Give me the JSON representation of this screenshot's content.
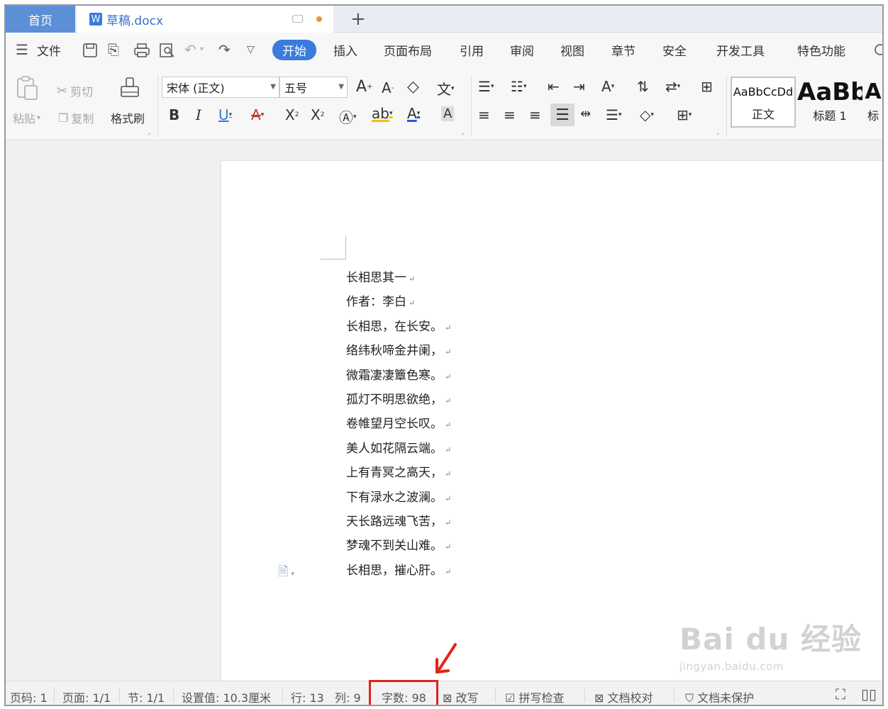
{
  "tabs": {
    "home_label": "首页",
    "doc_icon": "W",
    "doc_title": "草稿.docx",
    "add_label": "+"
  },
  "menu": {
    "file": "文件",
    "items": [
      "开始",
      "插入",
      "页面布局",
      "引用",
      "审阅",
      "视图",
      "章节",
      "安全",
      "开发工具",
      "特色功能"
    ],
    "active_index": 0,
    "accent_color": "#3a7bdb"
  },
  "ribbon": {
    "paste": "粘贴",
    "cut": "剪切",
    "copy": "复制",
    "format_painter": "格式刷",
    "font_name": "宋体 (正文)",
    "font_size": "五号",
    "styles": [
      {
        "preview": "AaBbCcDd",
        "name": "正文"
      },
      {
        "preview": "AaBb",
        "name": "标题 1"
      },
      {
        "preview": "A",
        "name": "标"
      }
    ]
  },
  "document": {
    "lines": [
      "长相思其一",
      "作者：李白",
      "长相思，在长安。",
      "络纬秋啼金井阑，",
      "微霜凄凄簟色寒。",
      "孤灯不明思欲绝，",
      "卷帷望月空长叹。",
      "美人如花隔云端。",
      "上有青冥之高天，",
      "下有渌水之波澜。",
      "天长路远魂飞苦，",
      "梦魂不到关山难。",
      "长相思，摧心肝。"
    ],
    "paragraph_mark": "↵"
  },
  "status": {
    "page_num": "页码: 1",
    "page": "页面: 1/1",
    "section": "节: 1/1",
    "setting": "设置值: 10.3厘米",
    "row": "行: 13",
    "col": "列: 9",
    "word_count": "字数: 98",
    "revise": "改写",
    "spell": "拼写检查",
    "proof": "文档校对",
    "protect": "文档未保护"
  },
  "watermark": {
    "main": "Bai du 经验",
    "sub": "jingyan.baidu.com"
  },
  "colors": {
    "highlight": "#e2231a",
    "tab_home": "#5b8fd8"
  }
}
